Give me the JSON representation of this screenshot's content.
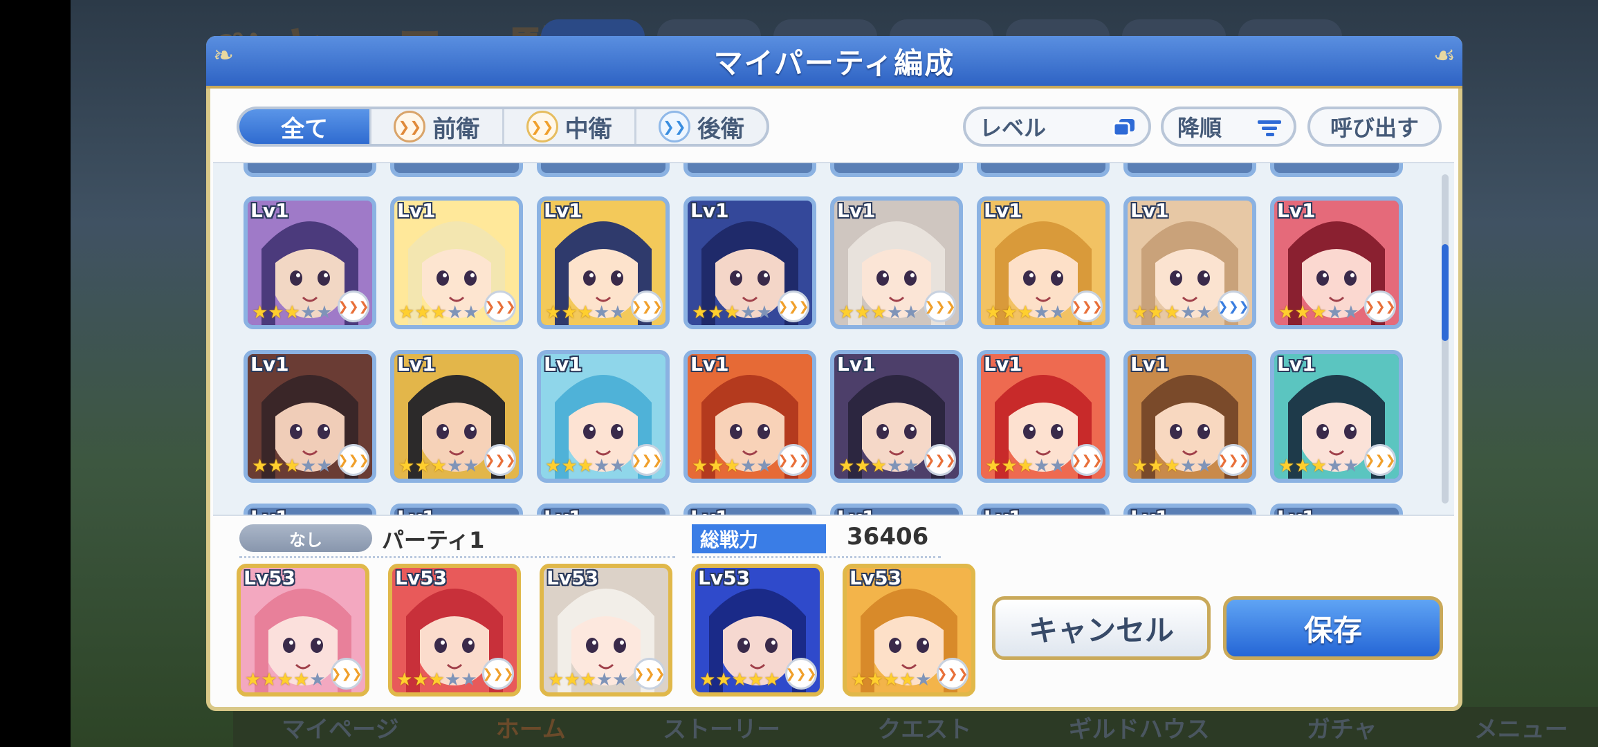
{
  "background": {
    "title": "キャラ一覧",
    "nav": [
      "マイページ",
      "ホーム",
      "ストーリー",
      "クエスト",
      "ギルドハウス",
      "ガチャ",
      "メニュー"
    ]
  },
  "modal": {
    "title": "マイパーティ編成",
    "filter_tabs": [
      {
        "label": "全て",
        "active": true,
        "icon": null
      },
      {
        "label": "前衛",
        "active": false,
        "icon": "front-role-icon"
      },
      {
        "label": "中衛",
        "active": false,
        "icon": "middle-role-icon"
      },
      {
        "label": "後衛",
        "active": false,
        "icon": "back-role-icon"
      }
    ],
    "sort": {
      "level_label": "レベル",
      "order_label": "降順",
      "recall_label": "呼び出す"
    },
    "roster": {
      "scroll_position": 0.3,
      "rows": [
        [
          {
            "lv": "Lv1",
            "stars": 3,
            "role": "front",
            "palette": [
              "#4b3a7c",
              "#9f7ac8",
              "#f2d7c4"
            ]
          },
          {
            "lv": "Lv1",
            "stars": 3,
            "role": "front",
            "palette": [
              "#f3e6b0",
              "#ffe89a",
              "#fde5d0"
            ]
          },
          {
            "lv": "Lv1",
            "stars": 3,
            "role": "mid",
            "palette": [
              "#2f3a6c",
              "#f3c95a",
              "#fde3cc"
            ]
          },
          {
            "lv": "Lv1",
            "stars": 3,
            "role": "mid",
            "palette": [
              "#1f2a6a",
              "#34489a",
              "#f4d6c8"
            ]
          },
          {
            "lv": "Lv1",
            "stars": 3,
            "role": "mid",
            "palette": [
              "#e8e2dc",
              "#cfc6c0",
              "#fbe5d6"
            ]
          },
          {
            "lv": "Lv1",
            "stars": 3,
            "role": "front",
            "palette": [
              "#d99a3a",
              "#f2c263",
              "#fde0c8"
            ]
          },
          {
            "lv": "Lv1",
            "stars": 3,
            "role": "back",
            "palette": [
              "#c9a27a",
              "#e7c8a5",
              "#fbe3d0"
            ]
          },
          {
            "lv": "Lv1",
            "stars": 3,
            "role": "front",
            "palette": [
              "#8a2030",
              "#e56a7a",
              "#fbd8d0"
            ]
          }
        ],
        [
          {
            "lv": "Lv1",
            "stars": 3,
            "role": "mid",
            "palette": [
              "#3a2628",
              "#6a3c34",
              "#f0cdb8"
            ]
          },
          {
            "lv": "Lv1",
            "stars": 3,
            "role": "front",
            "palette": [
              "#2c2a2a",
              "#e3b64a",
              "#f6d2b8"
            ]
          },
          {
            "lv": "Lv1",
            "stars": 3,
            "role": "mid",
            "palette": [
              "#4fb2d8",
              "#8fd6ea",
              "#fde3d3"
            ]
          },
          {
            "lv": "Lv1",
            "stars": 3,
            "role": "front",
            "palette": [
              "#b43a1e",
              "#e66a36",
              "#f8d2b8"
            ]
          },
          {
            "lv": "Lv1",
            "stars": 3,
            "role": "front",
            "palette": [
              "#2c2640",
              "#4d3f6a",
              "#f5d8c8"
            ]
          },
          {
            "lv": "Lv1",
            "stars": 3,
            "role": "front",
            "palette": [
              "#c82a2a",
              "#ee6a50",
              "#fde1d0"
            ]
          },
          {
            "lv": "Lv1",
            "stars": 3,
            "role": "front",
            "palette": [
              "#7a4a2a",
              "#c98a4a",
              "#f8d8c0"
            ]
          },
          {
            "lv": "Lv1",
            "stars": 3,
            "role": "mid",
            "palette": [
              "#1e3a4a",
              "#5bc5c0",
              "#fbe2d8"
            ]
          }
        ]
      ],
      "peek_label": "Lv1"
    },
    "party": {
      "badge": "なし",
      "name": "パーティ1",
      "power_label": "総戦力",
      "power_value": "36406",
      "members": [
        {
          "lv": "Lv53",
          "stars": 4,
          "role": "mid",
          "palette": [
            "#e8809a",
            "#f3a8c0",
            "#fbe0dc"
          ]
        },
        {
          "lv": "Lv53",
          "stars": 3,
          "role": "mid",
          "palette": [
            "#c8303a",
            "#e85a5a",
            "#fbdccc"
          ]
        },
        {
          "lv": "Lv53",
          "stars": 3,
          "role": "mid",
          "palette": [
            "#f2eee8",
            "#dcd2c8",
            "#fde8de"
          ]
        },
        {
          "lv": "Lv53",
          "stars": 5,
          "role": "mid",
          "palette": [
            "#1a2a88",
            "#2f4acb",
            "#f6d8d0"
          ]
        },
        {
          "lv": "Lv53",
          "stars": 4,
          "role": "front",
          "palette": [
            "#d88a2a",
            "#f3b44a",
            "#fde0c8"
          ]
        }
      ]
    },
    "buttons": {
      "cancel": "キャンセル",
      "save": "保存"
    }
  },
  "colors": {
    "header_blue": "#2e63c4",
    "gold_border": "#c9a95a",
    "star": "#ffcf2e"
  }
}
